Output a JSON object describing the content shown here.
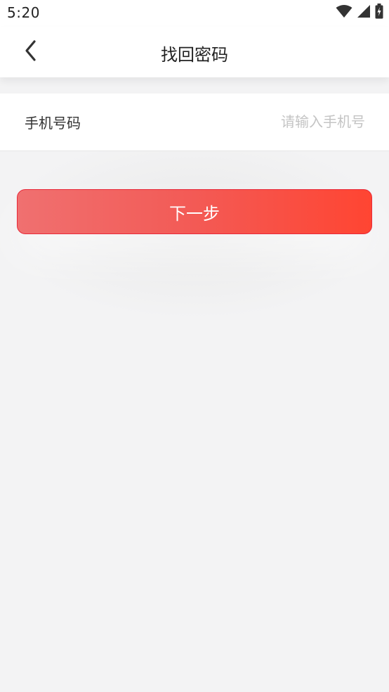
{
  "status_bar": {
    "time": "5:20",
    "icons": [
      "wifi-icon",
      "signal-icon",
      "battery-charging-icon"
    ]
  },
  "nav": {
    "title": "找回密码",
    "back_icon": "chevron-left-icon"
  },
  "form": {
    "phone_label": "手机号码",
    "phone_value": "",
    "phone_placeholder": "请输入手机号"
  },
  "actions": {
    "next_label": "下一步"
  },
  "colors": {
    "button_start": "#f07070",
    "button_end": "#ff4532",
    "button_border": "#e82a3a",
    "page_background": "#f3f3f4"
  }
}
